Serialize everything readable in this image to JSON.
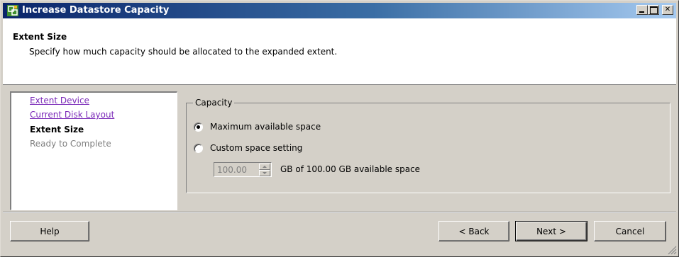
{
  "window": {
    "title": "Increase Datastore Capacity",
    "controls": {
      "minimize": "minimize",
      "maximize": "maximize",
      "close": "✕"
    }
  },
  "header": {
    "title": "Extent Size",
    "description": "Specify how much capacity should be allocated to the expanded extent."
  },
  "nav": {
    "items": [
      {
        "label": "Extent Device",
        "state": "link"
      },
      {
        "label": "Current Disk Layout",
        "state": "link"
      },
      {
        "label": "Extent Size",
        "state": "current"
      },
      {
        "label": "Ready to Complete",
        "state": "pending"
      }
    ]
  },
  "capacity": {
    "group_label": "Capacity",
    "options": [
      {
        "label": "Maximum available space",
        "checked": true
      },
      {
        "label": "Custom space setting",
        "checked": false
      }
    ],
    "spinner_value": "100.00",
    "spinner_note": "GB of 100.00 GB available space"
  },
  "buttons": {
    "help": "Help",
    "back": "< Back",
    "next": "Next >",
    "cancel": "Cancel"
  },
  "colors": {
    "title_gradient_start": "#0a246a",
    "title_gradient_end": "#a6caf0",
    "link": "#7a28b8",
    "face": "#d4d0c8"
  },
  "icons": {
    "app": "vsphere-app-icon",
    "radio_checked": "radio-checked-icon",
    "radio_unchecked": "radio-unchecked-icon",
    "spin_up": "spin-up-arrow-icon",
    "spin_down": "spin-down-arrow-icon",
    "resize": "resize-grip-icon"
  }
}
